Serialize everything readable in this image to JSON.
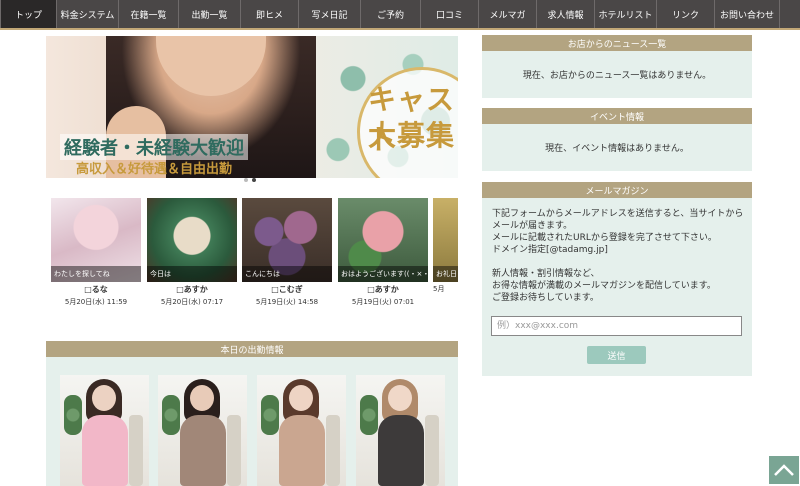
{
  "nav": {
    "items": [
      {
        "label": "トップ"
      },
      {
        "label": "料金システム"
      },
      {
        "label": "在籍一覧"
      },
      {
        "label": "出勤一覧"
      },
      {
        "label": "即ヒメ"
      },
      {
        "label": "写メ日記"
      },
      {
        "label": "ご予約"
      },
      {
        "label": "口コミ"
      },
      {
        "label": "メルマガ"
      },
      {
        "label": "求人情報"
      },
      {
        "label": "ホテルリスト"
      },
      {
        "label": "リンク"
      },
      {
        "label": "お問い合わせ"
      }
    ]
  },
  "hero": {
    "headline": "経験者・未経験大歓迎",
    "subline": "高収入＆好待遇＆自由出勤",
    "title_line1": "キャスト",
    "title_line2": "大募集"
  },
  "diary": [
    {
      "caption": "わたしを探してね",
      "name": "□るな",
      "date": "5月20日(水) 11:59"
    },
    {
      "caption": "今日は",
      "name": "□あすか",
      "date": "5月20日(水) 07:17"
    },
    {
      "caption": "こんにちは",
      "name": "□こむぎ",
      "date": "5月19日(火) 14:58"
    },
    {
      "caption": "おはようございます((・×・))",
      "name": "□あすか",
      "date": "5月19日(火) 07:01"
    },
    {
      "caption": "お礼日",
      "name": "",
      "date": "5月"
    }
  ],
  "attendance": {
    "heading": "本日の出勤情報"
  },
  "news": {
    "heading": "お店からのニュース一覧",
    "message": "現在、お店からのニュース一覧はありません。"
  },
  "events": {
    "heading": "イベント情報",
    "message": "現在、イベント情報はありません。"
  },
  "mailmag": {
    "heading": "メールマガジン",
    "paragraph1": "下記フォームからメールアドレスを送信すると、当サイトからメールが届きます。\nメールに記載されたURLから登録を完了させて下さい。\nドメイン指定[@tadamg.jp]",
    "paragraph2": "新人情報・割引情報など、\nお得な情報が満載のメールマガジンを配信しています。\nご登録お待ちしています。",
    "placeholder": "例）xxx@xxx.com",
    "submit_label": "送信"
  },
  "colors": {
    "nav_bg": "#4a4747",
    "accent": "#b3a481",
    "panel_bg": "#e5f0ec",
    "button": "#9cc9bd"
  }
}
